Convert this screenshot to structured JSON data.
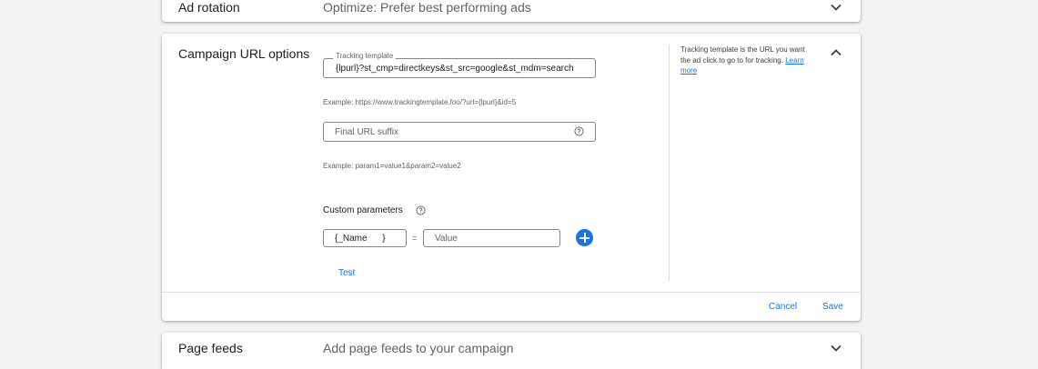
{
  "ad_rotation": {
    "title": "Ad rotation",
    "summary": "Optimize: Prefer best performing ads",
    "expand_icon": "chevron-down-icon"
  },
  "campaign_url_options": {
    "title": "Campaign URL options",
    "collapse_icon": "chevron-up-icon",
    "tracking_template": {
      "label": "Tracking template",
      "value": "{lpurl}?st_cmp=directkeys&st_src=google&st_mdm=search",
      "example": "Example: https://www.trackingtemplate.foo/?url={lpurl}&id=5"
    },
    "final_url_suffix": {
      "placeholder": "Final URL suffix",
      "help_icon": "help-circle-icon",
      "example": "Example: param1=value1&param2=value2"
    },
    "custom_parameters": {
      "label": "Custom parameters",
      "help_icon": "help-circle-icon",
      "name_placeholder": "{_Name      }",
      "equals": "=",
      "value_placeholder": "Value",
      "add_icon": "add-circle-icon"
    },
    "test_label": "Test",
    "help_panel": {
      "text": "Tracking template is the URL you want the ad click to go to for tracking.",
      "link": "Learn more"
    },
    "cancel_label": "Cancel",
    "save_label": "Save"
  },
  "page_feeds": {
    "title": "Page feeds",
    "summary": "Add page feeds to your campaign",
    "expand_icon": "chevron-down-icon"
  },
  "colors": {
    "accent": "#1a73e8",
    "background": "#f1f3f4",
    "card": "#ffffff",
    "text": "#202124",
    "secondary_text": "#5f6368"
  }
}
